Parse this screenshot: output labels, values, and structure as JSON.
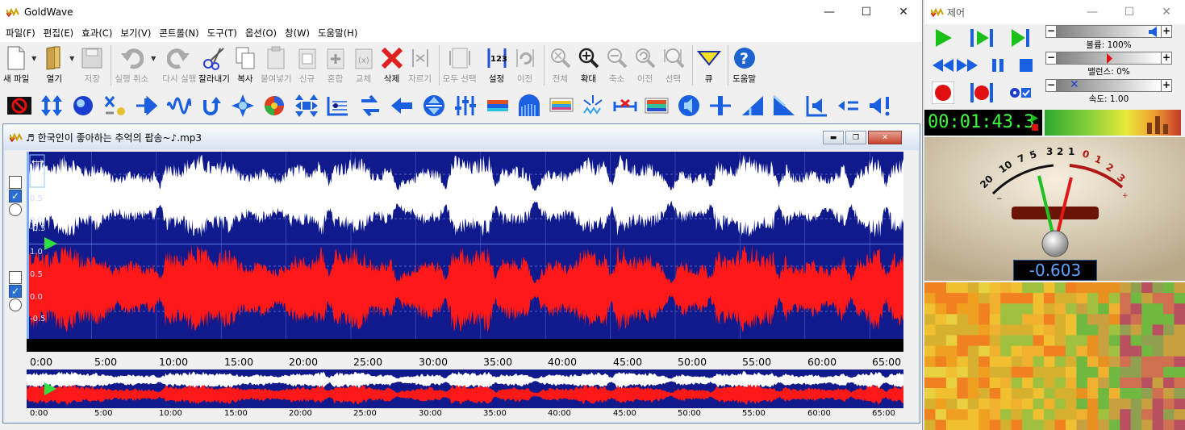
{
  "app": {
    "title": "GoldWave"
  },
  "window_controls": {
    "minimize": "—",
    "maximize": "☐",
    "close": "✕"
  },
  "menu": [
    "파일(F)",
    "편집(E)",
    "효과(C)",
    "보기(V)",
    "콘트롤(N)",
    "도구(T)",
    "옵션(O)",
    "창(W)",
    "도움말(H)"
  ],
  "toolbar": {
    "new": "새 파일",
    "open": "열기",
    "save": "저장",
    "undo": "실행 취소",
    "redo": "다시 실행",
    "cut": "잘라내기",
    "copy": "복사",
    "paste": "붙여넣기",
    "paste_new": "신규",
    "mix": "혼합",
    "replace": "교체",
    "delete": "삭제",
    "trim": "자르기",
    "select_all": "모두 선택",
    "set": "설정",
    "previous": "이전",
    "all": "전체",
    "zoom_in": "확대",
    "zoom_out": "축소",
    "zoom_prev": "이전",
    "zoom_sel": "선택",
    "cue": "큐",
    "help": "도움말"
  },
  "wave_window": {
    "title": "♬ 한국인이 좋아하는 추억의 팝송~♪.mp3",
    "main_timeline": [
      "0:00",
      "5:00",
      "10:00",
      "15:00",
      "20:00",
      "25:00",
      "30:00",
      "35:00",
      "40:00",
      "45:00",
      "50:00",
      "55:00",
      "60:00",
      "65:00"
    ],
    "overview_timeline": [
      "0:00",
      "5:00",
      "10:00",
      "15:00",
      "20:00",
      "25:00",
      "30:00",
      "35:00",
      "40:00",
      "45:00",
      "50:00",
      "55:00",
      "60:00",
      "65:00"
    ],
    "left_axis": [
      "0.5",
      "0.0",
      "-0.5"
    ],
    "right_axis": [
      "1.0",
      "0.5",
      "0.0",
      "-0.5"
    ],
    "colors": {
      "background": "#101a8c",
      "left_channel": "#ffffff",
      "right_channel": "#ff1818"
    }
  },
  "control": {
    "title": "제어",
    "volume_label": "볼륨: 100%",
    "balance_label": "밸런스: 0%",
    "speed_label": "속도: 1.00",
    "volume": 1.0,
    "balance": 0.0,
    "time": "00:01:43.3",
    "meter_value": "-0.603",
    "meter_scale_black": [
      "20",
      "10",
      "7",
      "5",
      "3",
      "2",
      "1"
    ],
    "meter_scale_red": [
      "0",
      "1",
      "2",
      "3"
    ]
  }
}
